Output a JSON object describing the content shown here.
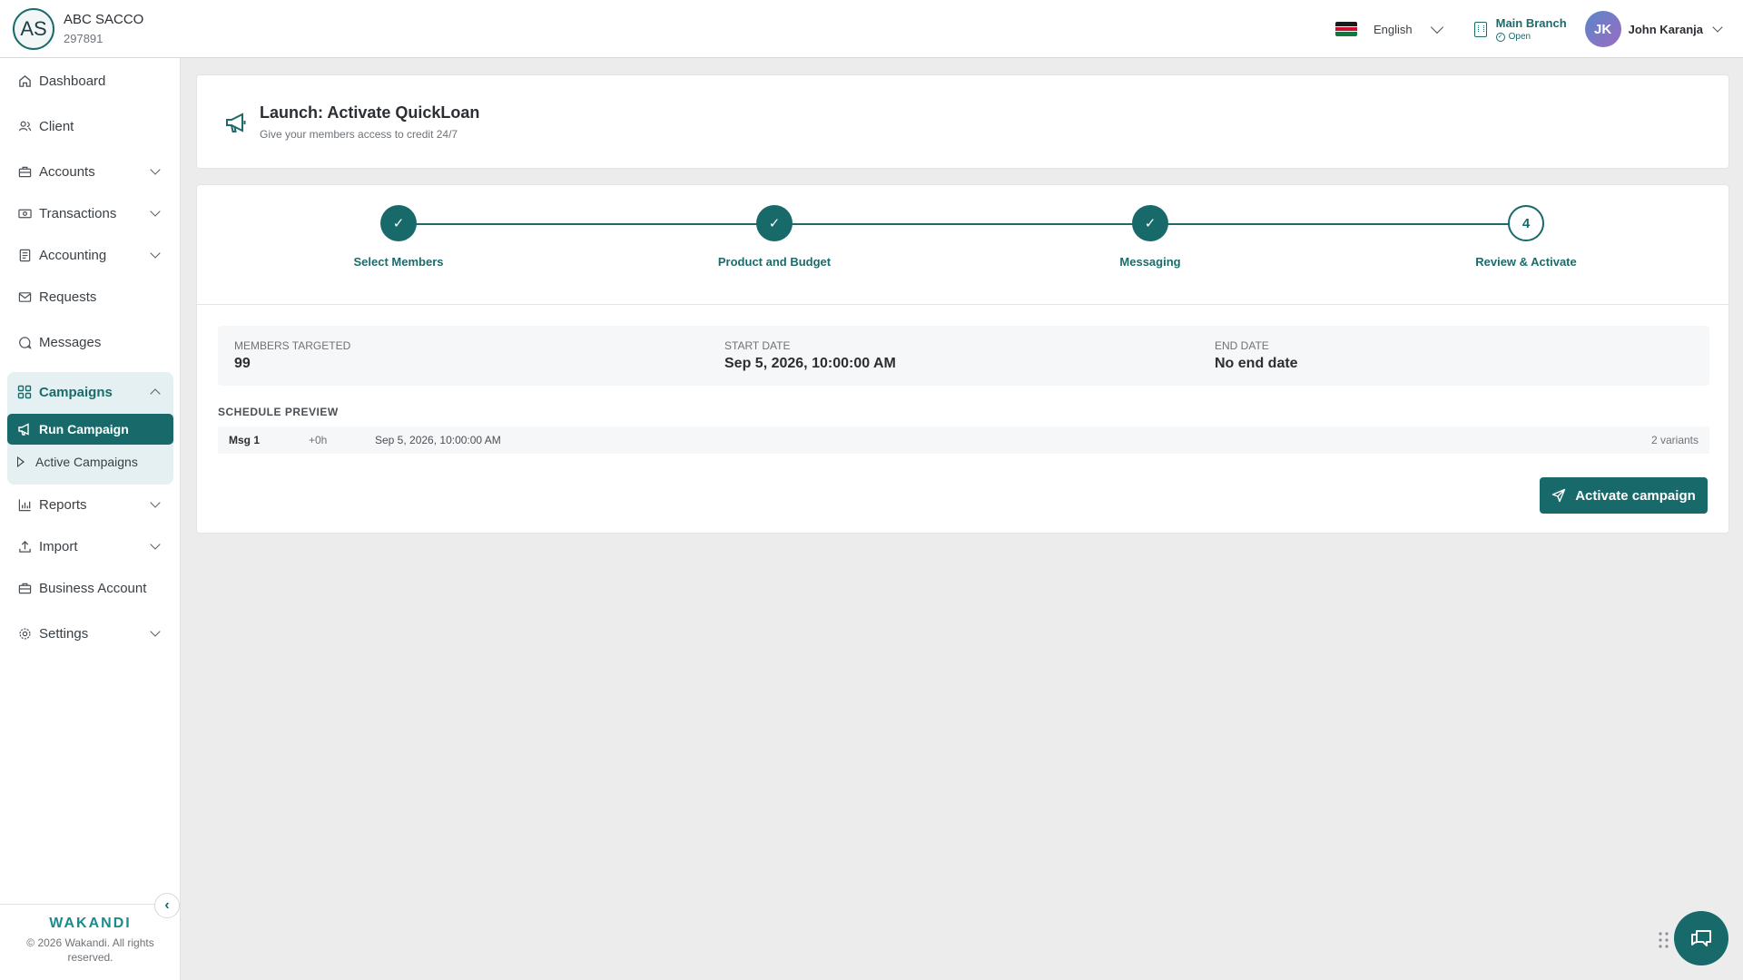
{
  "org": {
    "initials": "AS",
    "name": "ABC SACCO",
    "code": "297891"
  },
  "header": {
    "language": "English",
    "branch_name": "Main Branch",
    "branch_status": "Open",
    "user_initials": "JK",
    "user_name": "John Karanja"
  },
  "sidebar": {
    "items": [
      {
        "label": "Dashboard",
        "icon": "home-icon"
      },
      {
        "label": "Client",
        "icon": "users-icon"
      },
      {
        "label": "Accounts",
        "icon": "briefcase-icon"
      },
      {
        "label": "Transactions",
        "icon": "cash-icon"
      },
      {
        "label": "Accounting",
        "icon": "ledger-icon"
      },
      {
        "label": "Requests",
        "icon": "mail-icon"
      },
      {
        "label": "Messages",
        "icon": "chat-icon"
      },
      {
        "label": "Campaigns",
        "icon": "grid-icon"
      },
      {
        "label": "Reports",
        "icon": "chart-icon"
      },
      {
        "label": "Import",
        "icon": "upload-icon"
      },
      {
        "label": "Business Account",
        "icon": "briefcase-icon"
      },
      {
        "label": "Settings",
        "icon": "gear-icon"
      }
    ],
    "campaign_sub": {
      "run": "Run Campaign",
      "active": "Active Campaigns"
    },
    "footer": {
      "brand": "WAKANDI",
      "copyright": "© 2026 Wakandi. All rights reserved."
    }
  },
  "launch": {
    "title": "Launch: Activate QuickLoan",
    "subtitle": "Give your members access to credit 24/7"
  },
  "wizard": {
    "steps": [
      {
        "label": "Select Members",
        "state": "done"
      },
      {
        "label": "Product and Budget",
        "state": "done"
      },
      {
        "label": "Messaging",
        "state": "done"
      },
      {
        "label": "Review & Activate",
        "state": "current",
        "number": "4"
      }
    ],
    "summary": {
      "members_label": "MEMBERS TARGETED",
      "members_value": "99",
      "start_label": "START DATE",
      "start_value": "Sep 5, 2026, 10:00:00 AM",
      "end_label": "END DATE",
      "end_value": "No end date"
    },
    "schedule": {
      "title": "SCHEDULE PREVIEW",
      "rows": [
        {
          "msg": "Msg 1",
          "offset": "+0h",
          "date": "Sep 5, 2026, 10:00:00 AM",
          "variants": "2 variants"
        }
      ]
    },
    "activate_label": "Activate campaign"
  },
  "colors": {
    "brand": "#18696a",
    "background": "#ececec",
    "campaign_group_bg": "#e4f0f1"
  }
}
